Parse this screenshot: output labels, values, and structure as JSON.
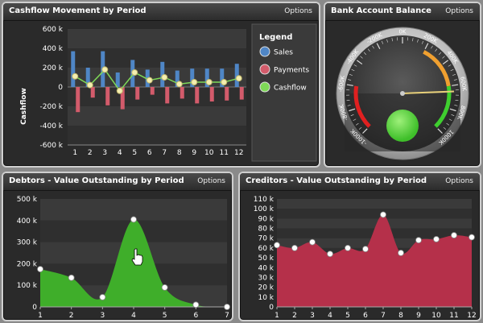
{
  "colors": {
    "sales": "#4f86c6",
    "payments": "#d35b6b",
    "cashflow": "#7ed957",
    "debtors_area": "#3fae2a",
    "creditors_area": "#b5304a",
    "panel_bg": "#2a2a2a"
  },
  "cashflow_panel": {
    "title": "Cashflow Movement by Period",
    "options": "Options",
    "legend_title": "Legend",
    "legend": [
      {
        "label": "Sales",
        "color": "#4f86c6"
      },
      {
        "label": "Payments",
        "color": "#d35b6b"
      },
      {
        "label": "Cashflow",
        "color": "#7ed957"
      }
    ]
  },
  "gauge_panel": {
    "title": "Bank Account Balance",
    "options": "Options",
    "labels": [
      "-1000K",
      "-800K",
      "-600K",
      "-400K",
      "-200K",
      "0K",
      "200K",
      "400K",
      "600K",
      "800K",
      "1000K"
    ]
  },
  "debtors_panel": {
    "title": "Debtors - Value Outstanding by Period",
    "options": "Options"
  },
  "creditors_panel": {
    "title": "Creditors - Value Outstanding by Period",
    "options": "Options"
  },
  "chart_data": [
    {
      "type": "bar",
      "title": "Cashflow Movement by Period",
      "xlabel": "",
      "ylabel": "Cashflow",
      "categories": [
        "1",
        "2",
        "3",
        "4",
        "5",
        "6",
        "7",
        "8",
        "9",
        "10",
        "11",
        "12"
      ],
      "y_ticks": [
        "600 k",
        "400 k",
        "200 k",
        "0",
        "-200 k",
        "-400 k",
        "-600 k"
      ],
      "ylim": [
        -600000,
        600000
      ],
      "series": [
        {
          "name": "Sales",
          "kind": "bar",
          "values": [
            370000,
            200000,
            370000,
            150000,
            280000,
            180000,
            260000,
            170000,
            190000,
            190000,
            190000,
            240000
          ]
        },
        {
          "name": "Payments",
          "kind": "bar",
          "values": [
            -260000,
            -110000,
            -190000,
            -230000,
            -130000,
            -80000,
            -170000,
            -120000,
            -170000,
            -150000,
            -140000,
            -130000
          ]
        },
        {
          "name": "Cashflow",
          "kind": "line",
          "values": [
            110000,
            20000,
            180000,
            -40000,
            150000,
            70000,
            100000,
            30000,
            50000,
            50000,
            50000,
            90000
          ]
        }
      ],
      "grid": true,
      "legend": "right"
    },
    {
      "type": "gauge",
      "title": "Bank Account Balance",
      "min": -1000000,
      "max": 1000000,
      "value": 650000,
      "ranges": [
        {
          "from": -1000000,
          "to": -600000,
          "color": "#e02020"
        },
        {
          "from": 200000,
          "to": 600000,
          "color": "#f0a030"
        },
        {
          "from": 600000,
          "to": 1000000,
          "color": "#3fcf2f"
        }
      ]
    },
    {
      "type": "area",
      "title": "Debtors - Value Outstanding by Period",
      "x": [
        "1",
        "2",
        "3",
        "4",
        "5",
        "6",
        "7"
      ],
      "y_ticks": [
        "500 k",
        "400 k",
        "300 k",
        "200 k",
        "100 k",
        "0"
      ],
      "ylim": [
        0,
        500000
      ],
      "values": [
        175000,
        135000,
        45000,
        405000,
        90000,
        10000,
        0
      ],
      "grid": true
    },
    {
      "type": "area",
      "title": "Creditors - Value Outstanding by Period",
      "x": [
        "1",
        "2",
        "3",
        "4",
        "5",
        "6",
        "7",
        "8",
        "9",
        "10",
        "11",
        "12"
      ],
      "y_ticks": [
        "110 k",
        "100 k",
        "90 k",
        "80 k",
        "70 k",
        "60 k",
        "50 k",
        "40 k",
        "30 k",
        "20 k",
        "10 k",
        "0"
      ],
      "ylim": [
        0,
        110000
      ],
      "values": [
        63000,
        60000,
        66000,
        54000,
        60000,
        59000,
        94000,
        55000,
        68000,
        69000,
        73000,
        71000
      ],
      "grid": true
    }
  ]
}
